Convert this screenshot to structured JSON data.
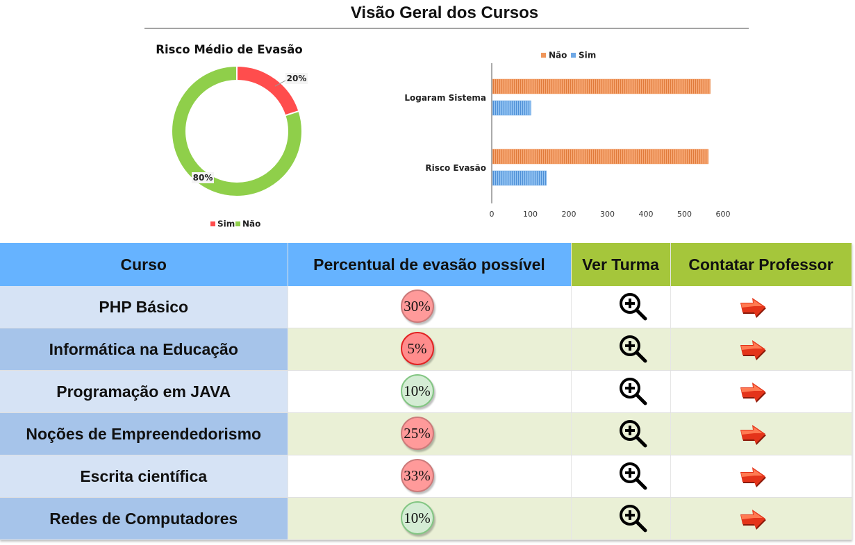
{
  "page": {
    "title": "Visão Geral dos Cursos"
  },
  "donut_chart": {
    "title": "Risco Médio de Evasão",
    "legend": [
      "Sim",
      "Não"
    ]
  },
  "bar_chart": {
    "legend": [
      "Não",
      "Sim"
    ]
  },
  "chart_data": [
    {
      "type": "pie",
      "title": "Risco Médio de Evasão",
      "categories": [
        "Sim",
        "Não"
      ],
      "values": [
        20,
        80
      ],
      "labels": [
        "20%",
        "80%"
      ],
      "colors": [
        "#ff4d4d",
        "#8fcf4a"
      ],
      "legend_position": "bottom"
    },
    {
      "type": "bar",
      "orientation": "horizontal",
      "categories": [
        "Logaram Sistema",
        "Risco Evasão"
      ],
      "series": [
        {
          "name": "Não",
          "values": [
            565,
            560
          ],
          "color": "#f0965a"
        },
        {
          "name": "Sim",
          "values": [
            100,
            140
          ],
          "color": "#6fa8e6"
        }
      ],
      "xlim": [
        0,
        600
      ],
      "xticks": [
        "0",
        "100",
        "200",
        "300",
        "400",
        "500",
        "600"
      ],
      "legend_position": "top"
    }
  ],
  "table": {
    "headers": {
      "course": "Curso",
      "percent": "Percentual de evasão possível",
      "view_class": "Ver Turma",
      "contact": "Contatar Professor"
    },
    "rows": [
      {
        "course": "PHP Básico",
        "percent": "30%",
        "level": "high"
      },
      {
        "course": "Informática na Educação",
        "percent": "5%",
        "level": "crit"
      },
      {
        "course": "Programação em JAVA",
        "percent": "10%",
        "level": "low"
      },
      {
        "course": "Noções de Empreendedorismo",
        "percent": "25%",
        "level": "high"
      },
      {
        "course": "Escrita científica",
        "percent": "33%",
        "level": "high"
      },
      {
        "course": "Redes de Computadores",
        "percent": "10%",
        "level": "low"
      }
    ],
    "icons": {
      "view_class": "zoom-in-icon",
      "contact": "red-arrow-icon"
    }
  }
}
